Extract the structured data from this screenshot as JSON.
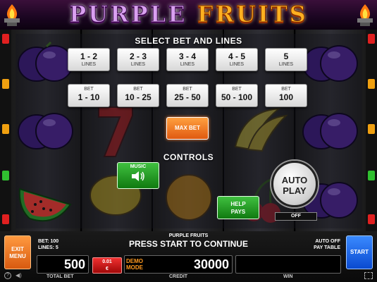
{
  "title": {
    "part1": "PURPLE",
    "part2": "FRUITS"
  },
  "menu": {
    "select_title": "SELECT BET AND LINES",
    "lines_options": [
      {
        "value": "1 - 2",
        "unit": "LINES"
      },
      {
        "value": "2 - 3",
        "unit": "LINES"
      },
      {
        "value": "3 - 4",
        "unit": "LINES"
      },
      {
        "value": "4 - 5",
        "unit": "LINES"
      },
      {
        "value": "5",
        "unit": "LINES"
      }
    ],
    "bet_options": [
      {
        "unit": "BET",
        "value": "1 - 10"
      },
      {
        "unit": "BET",
        "value": "10 - 25"
      },
      {
        "unit": "BET",
        "value": "25 - 50"
      },
      {
        "unit": "BET",
        "value": "50 - 100"
      },
      {
        "unit": "BET",
        "value": "100"
      }
    ],
    "max_bet": "MAX BET",
    "controls_title": "CONTROLS",
    "music_label": "MUSIC",
    "help_line1": "HELP",
    "help_line2": "PAYS",
    "auto_play_line1": "AUTO",
    "auto_play_line2": "PLAY",
    "auto_play_state": "OFF"
  },
  "bottom": {
    "game_name": "PURPLE FRUITS",
    "message": "PRESS START TO CONTINUE",
    "bet_info": "BET: 100",
    "lines_info": "LINES: 5",
    "auto_info": "AUTO OFF",
    "pay_table": "PAY TABLE",
    "exit_line1": "EXIT",
    "exit_line2": "MENU",
    "start": "START",
    "total_bet_value": "500",
    "total_bet_label": "TOTAL BET",
    "denom_value": "0.01",
    "denom_currency": "€",
    "demo_line1": "DEMO",
    "demo_line2": "MODE",
    "credit_value": "30000",
    "credit_label": "CREDIT",
    "win_value": "",
    "win_label": "WIN"
  },
  "colors": {
    "max_bet": "#e05a10",
    "green_button": "#107a10",
    "start_button": "#0a4ad0",
    "exit_button": "#d85a10",
    "denom_button": "#a00808",
    "demo_text": "#ff9a20"
  },
  "icons": {
    "music": "speaker-icon",
    "help": "question-icon",
    "sound": "sound-icon",
    "fullscreen": "fullscreen-icon"
  }
}
